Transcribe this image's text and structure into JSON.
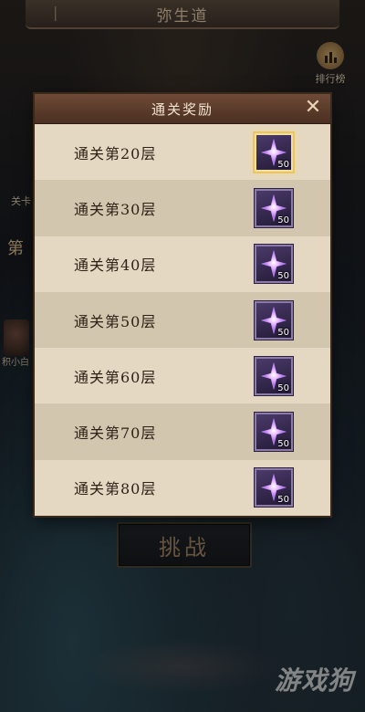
{
  "screen": {
    "title": "弥生道",
    "rank_label": "排行榜",
    "challenge_label": "挑战",
    "side_label_a": "关卡",
    "side_label_b": "第",
    "side_label_c": "积小白",
    "watermark": "游戏狗"
  },
  "modal": {
    "title": "通关奖励",
    "close_symbol": "✕",
    "rows": [
      {
        "label": "通关第20层",
        "reward_icon": "purple-star-crystal-icon",
        "count": "50",
        "highlighted": true
      },
      {
        "label": "通关第30层",
        "reward_icon": "purple-star-crystal-icon",
        "count": "50",
        "highlighted": false
      },
      {
        "label": "通关第40层",
        "reward_icon": "purple-star-crystal-icon",
        "count": "50",
        "highlighted": false
      },
      {
        "label": "通关第50层",
        "reward_icon": "purple-star-crystal-icon",
        "count": "50",
        "highlighted": false
      },
      {
        "label": "通关第60层",
        "reward_icon": "purple-star-crystal-icon",
        "count": "50",
        "highlighted": false
      },
      {
        "label": "通关第70层",
        "reward_icon": "purple-star-crystal-icon",
        "count": "50",
        "highlighted": false
      },
      {
        "label": "通关第80层",
        "reward_icon": "purple-star-crystal-icon",
        "count": "50",
        "highlighted": false
      }
    ]
  },
  "colors": {
    "modal_bg": "#e4d7c1",
    "row_alt": "#d3c6ae",
    "header": "#5b3c2c",
    "highlight_gold": "#e8c36a",
    "reward_purple": "#8c7aa8"
  }
}
